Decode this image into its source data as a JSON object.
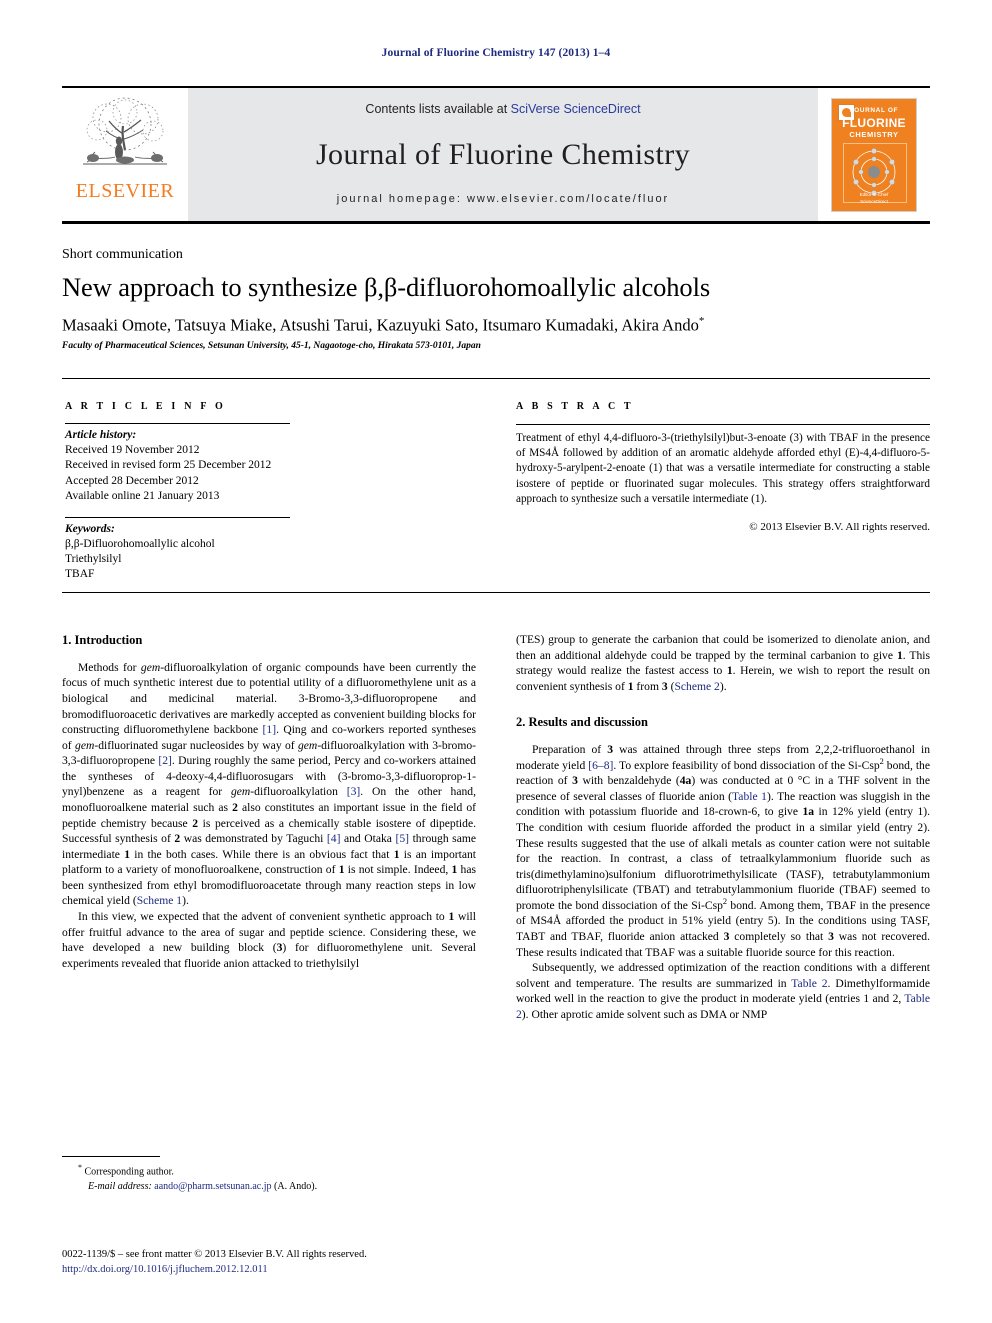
{
  "running_head": "Journal of Fluorine Chemistry 147 (2013) 1–4",
  "masthead": {
    "contents_prefix": "Contents lists available at ",
    "contents_link": "SciVerse ScienceDirect",
    "journal_name": "Journal of Fluorine Chemistry",
    "homepage_label": "journal homepage: www.elsevier.com/locate/fluor",
    "publisher_wordmark": "ELSEVIER",
    "cover": {
      "line1": "JOURNAL OF",
      "line2": "FLUORINE",
      "line3": "CHEMISTRY",
      "footer1": "Editor-in-Chief",
      "footer2": "ScienceDirect"
    }
  },
  "article": {
    "section_type": "Short communication",
    "title": "New approach to synthesize β,β-difluorohomoallylic alcohols",
    "authors": "Masaaki Omote, Tatsuya Miake, Atsushi Tarui, Kazuyuki Sato, Itsumaro Kumadaki, Akira Ando",
    "author_mark": "*",
    "affiliation": "Faculty of Pharmaceutical Sciences, Setsunan University, 45-1, Nagaotoge-cho, Hirakata 573-0101, Japan"
  },
  "info": {
    "header": "A R T I C L E   I N F O",
    "history_label": "Article history:",
    "history": [
      "Received 19 November 2012",
      "Received in revised form 25 December 2012",
      "Accepted 28 December 2012",
      "Available online 21 January 2013"
    ],
    "keywords_label": "Keywords:",
    "keywords": [
      "β,β-Difluorohomoallylic alcohol",
      "Triethylsilyl",
      "TBAF"
    ]
  },
  "abstract": {
    "header": "A B S T R A C T",
    "body": "Treatment of ethyl 4,4-difluoro-3-(triethylsilyl)but-3-enoate (3) with TBAF in the presence of MS4Å followed by addition of an aromatic aldehyde afforded ethyl (E)-4,4-difluoro-5-hydroxy-5-arylpent-2-enoate (1) that was a versatile intermediate for constructing a stable isostere of peptide or fluorinated sugar molecules. This strategy offers straightforward approach to synthesize such a versatile intermediate (1).",
    "copyright": "© 2013 Elsevier B.V. All rights reserved."
  },
  "body": {
    "intro_heading": "1. Introduction",
    "intro_p1": "Methods for gem-difluoroalkylation of organic compounds have been currently the focus of much synthetic interest due to potential utility of a difluoromethylene unit as a biological and medicinal material. 3-Bromo-3,3-difluoropropene and bromodifluoroacetic derivatives are markedly accepted as convenient building blocks for constructing difluoromethylene backbone [1]. Qing and co-workers reported syntheses of gem-difluorinated sugar nucleosides by way of gem-difluoroalkylation with 3-bromo-3,3-difluoropropene [2]. During roughly the same period, Percy and co-workers attained the syntheses of 4-deoxy-4,4-difluorosugars with (3-bromo-3,3-difluoroprop-1-ynyl)benzene as a reagent for gem-difluoroalkylation [3]. On the other hand, monofluoroalkene material such as 2 also constitutes an important issue in the field of peptide chemistry because 2 is perceived as a chemically stable isostere of dipeptide. Successful synthesis of 2 was demonstrated by Taguchi [4] and Otaka [5] through same intermediate 1 in the both cases. While there is an obvious fact that 1 is an important platform to a variety of monofluoroalkene, construction of 1 is not simple. Indeed, 1 has been synthesized from ethyl bromodifluoroacetate through many reaction steps in low chemical yield (Scheme 1).",
    "intro_p2": "In this view, we expected that the advent of convenient synthetic approach to 1 will offer fruitful advance to the area of sugar and peptide science. Considering these, we have developed a new building block (3) for difluoromethylene unit. Several experiments revealed that fluoride anion attacked to triethylsilyl",
    "right_p1": "(TES) group to generate the carbanion that could be isomerized to dienolate anion, and then an additional aldehyde could be trapped by the terminal carbanion to give 1. This strategy would realize the fastest access to 1. Herein, we wish to report the result on convenient synthesis of 1 from 3 (Scheme 2).",
    "results_heading": "2. Results and discussion",
    "results_p1": "Preparation of 3 was attained through three steps from 2,2,2-trifluoroethanol in moderate yield [6–8]. To explore feasibility of bond dissociation of the Si-Csp2 bond, the reaction of 3 with benzaldehyde (4a) was conducted at 0 °C in a THF solvent in the presence of several classes of fluoride anion (Table 1). The reaction was sluggish in the condition with potassium fluoride and 18-crown-6, to give 1a in 12% yield (entry 1). The condition with cesium fluoride afforded the product in a similar yield (entry 2). These results suggested that the use of alkali metals as counter cation were not suitable for the reaction. In contrast, a class of tetraalkylammonium fluoride such as tris(dimethylamino)sulfonium difluorotrimethylsilicate (TASF), tetrabutylammonium difluorotriphenylsilicate (TBAT) and tetrabutylammonium fluoride (TBAF) seemed to promote the bond dissociation of the Si-Csp2 bond. Among them, TBAF in the presence of MS4Å afforded the product in 51% yield (entry 5). In the conditions using TASF, TABT and TBAF, fluoride anion attacked 3 completely so that 3 was not recovered. These results indicated that TBAF was a suitable fluoride source for this reaction.",
    "results_p2": "Subsequently, we addressed optimization of the reaction conditions with a different solvent and temperature. The results are summarized in Table 2. Dimethylformamide worked well in the reaction to give the product in moderate yield (entries 1 and 2, Table 2). Other aprotic amide solvent such as DMA or NMP"
  },
  "footnotes": {
    "corresponding": "Corresponding author.",
    "email_label": "E-mail address:",
    "email": "aando@pharm.setsunan.ac.jp",
    "email_suffix": "(A. Ando).",
    "legal": "0022-1139/$ – see front matter © 2013 Elsevier B.V. All rights reserved.",
    "doi": "http://dx.doi.org/10.1016/j.jfluchem.2012.12.011"
  },
  "links": {
    "scheme1": "Scheme 1",
    "scheme2": "Scheme 2",
    "table1": "Table 1",
    "table2": "Table 2",
    "ref1": "[1]",
    "ref2": "[2]",
    "ref3": "[3]",
    "ref4": "[4]",
    "ref5": "[5]",
    "ref68": "[6–8]"
  },
  "colors": {
    "link": "#2a3a9c",
    "elsevier_orange": "#f47b20",
    "band_gray": "#e6e7e8"
  }
}
